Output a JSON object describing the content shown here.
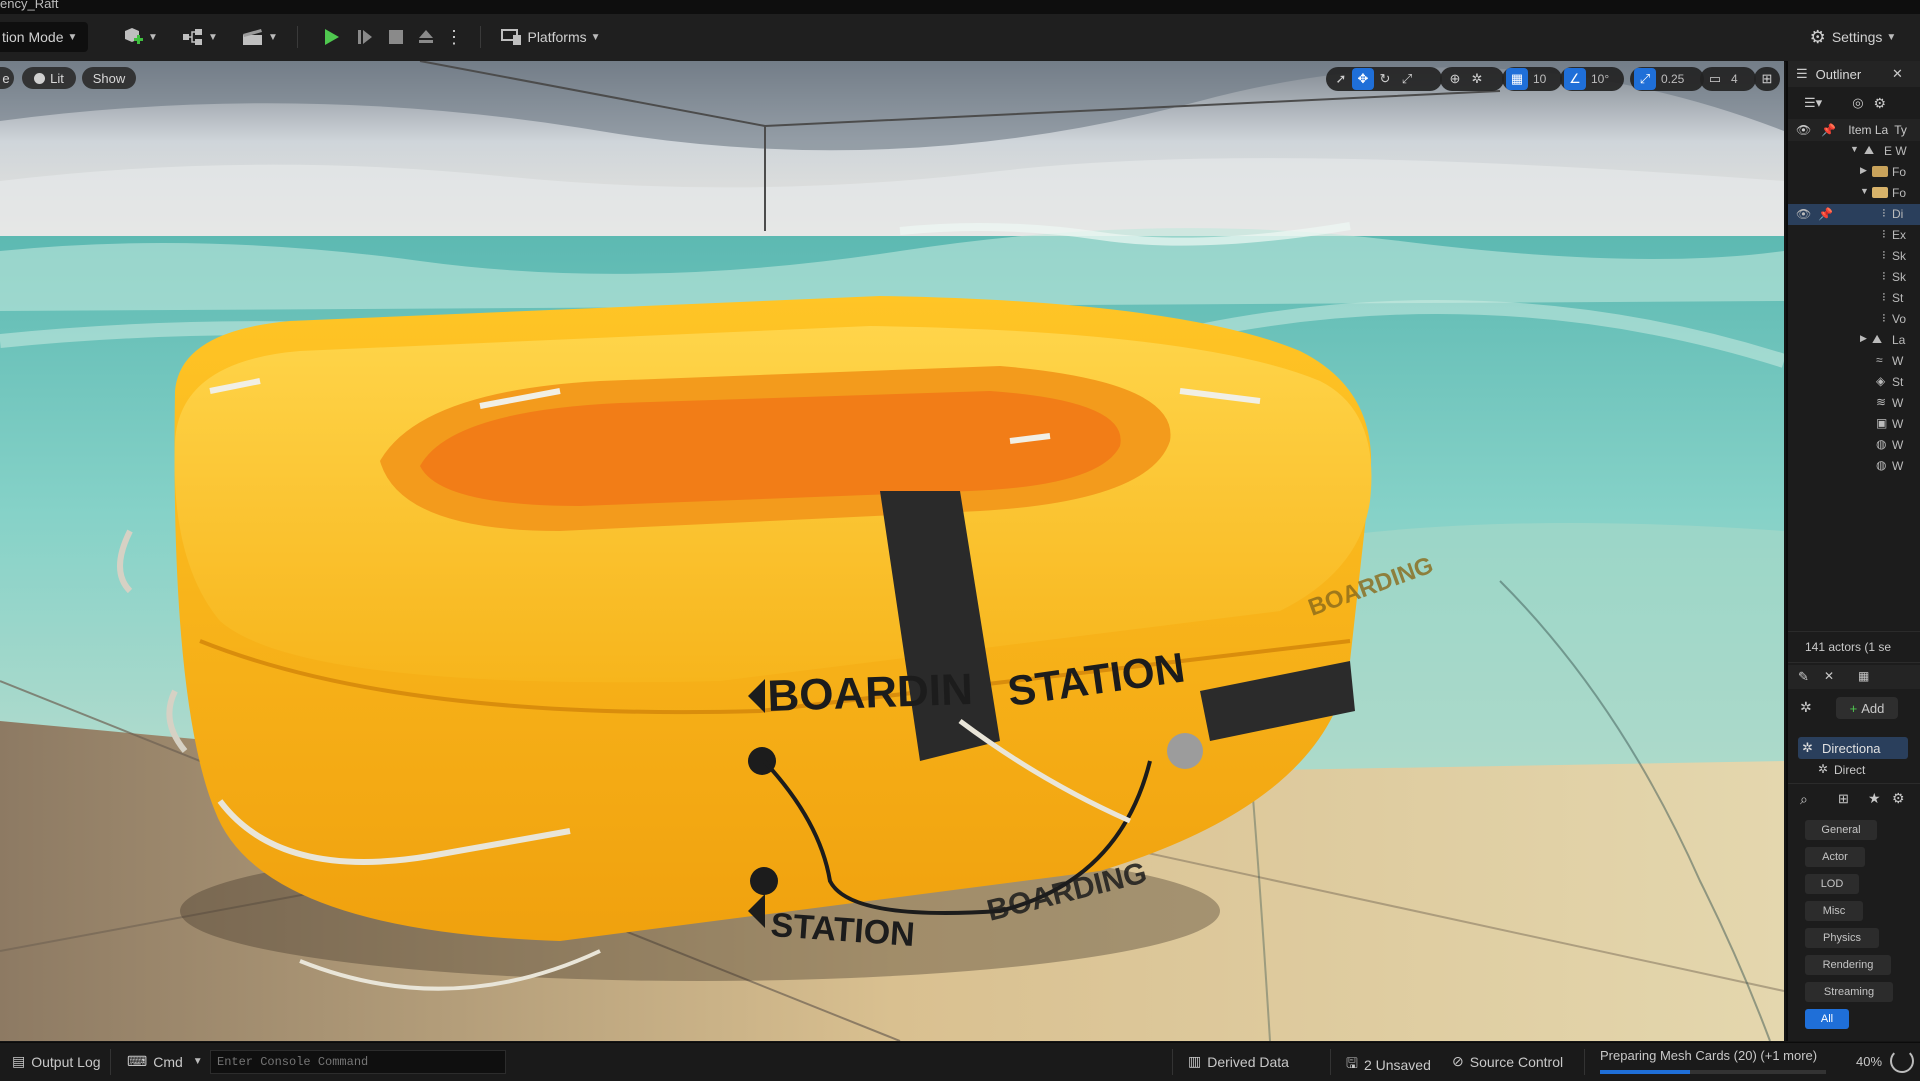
{
  "window": {
    "title_fragment": "ency_Raft"
  },
  "toolbar": {
    "mode_label": "tion Mode",
    "platforms_label": "Platforms",
    "settings_label": "Settings",
    "icons": [
      "add-actor-icon",
      "blueprint-icon",
      "cinematics-icon",
      "play-icon",
      "advance-frame-icon",
      "stop-icon",
      "eject-icon",
      "more-options-icon",
      "platforms-icon",
      "gear-icon"
    ]
  },
  "viewport": {
    "menu_fragment": "e",
    "view_mode_label": "Lit",
    "show_label": "Show",
    "grid_snap_value": "10",
    "angle_snap_value": "10°",
    "scale_snap_value": "0.25",
    "camera_speed_value": "4",
    "scene_text": {
      "side_label_1": "BOARDIN",
      "side_label_2": "STATION",
      "side_label_3": "BOARDING",
      "lower_label_1": "STATION",
      "lower_label_2": "BOARDING"
    },
    "accent_color": "#1f6fd8"
  },
  "outliner": {
    "title": "Outliner",
    "column_item_label": "Item La",
    "column_type_label": "Ty",
    "rows": [
      {
        "label": "E W",
        "icon": "world-icon",
        "expanded": true,
        "selected": false
      },
      {
        "label": "Fo",
        "icon": "folder-icon",
        "expanded": false,
        "selected": false
      },
      {
        "label": "Fo",
        "icon": "folder-open-icon",
        "expanded": true,
        "selected": false
      },
      {
        "label": "Di",
        "icon": "directional-light-icon",
        "selected": true
      },
      {
        "label": "Ex",
        "icon": "actor-icon",
        "selected": false
      },
      {
        "label": "Sk",
        "icon": "actor-icon",
        "selected": false
      },
      {
        "label": "Sk",
        "icon": "actor-icon",
        "selected": false
      },
      {
        "label": "St",
        "icon": "actor-icon",
        "selected": false
      },
      {
        "label": "Vo",
        "icon": "actor-icon",
        "selected": false
      },
      {
        "label": "La",
        "icon": "landscape-icon",
        "expanded": false,
        "selected": false
      },
      {
        "label": "W",
        "icon": "water-icon",
        "selected": false
      },
      {
        "label": "St",
        "icon": "mesh-icon",
        "selected": false
      },
      {
        "label": "W",
        "icon": "water-icon",
        "selected": false
      },
      {
        "label": "W",
        "icon": "water-icon",
        "selected": false
      },
      {
        "label": "W",
        "icon": "water-icon",
        "selected": false
      },
      {
        "label": "W",
        "icon": "water-icon",
        "selected": false
      }
    ],
    "actor_count": "141 actors (1 se"
  },
  "details": {
    "add_label": "Add",
    "component_label": "Directiona",
    "subcomponent_label": "Direct",
    "categories": [
      "General",
      "Actor",
      "LOD",
      "Misc",
      "Physics",
      "Rendering",
      "Streaming",
      "All"
    ],
    "active_category": "All"
  },
  "statusbar": {
    "output_log_label": "Output Log",
    "cmd_label": "Cmd",
    "console_placeholder": "Enter Console Command",
    "derived_data_label": "Derived Data",
    "unsaved_label": "2 Unsaved",
    "source_control_label": "Source Control",
    "progress_label": "Preparing Mesh Cards (20) (+1 more)",
    "progress_fraction": 0.4,
    "progress_percent": "40%"
  }
}
